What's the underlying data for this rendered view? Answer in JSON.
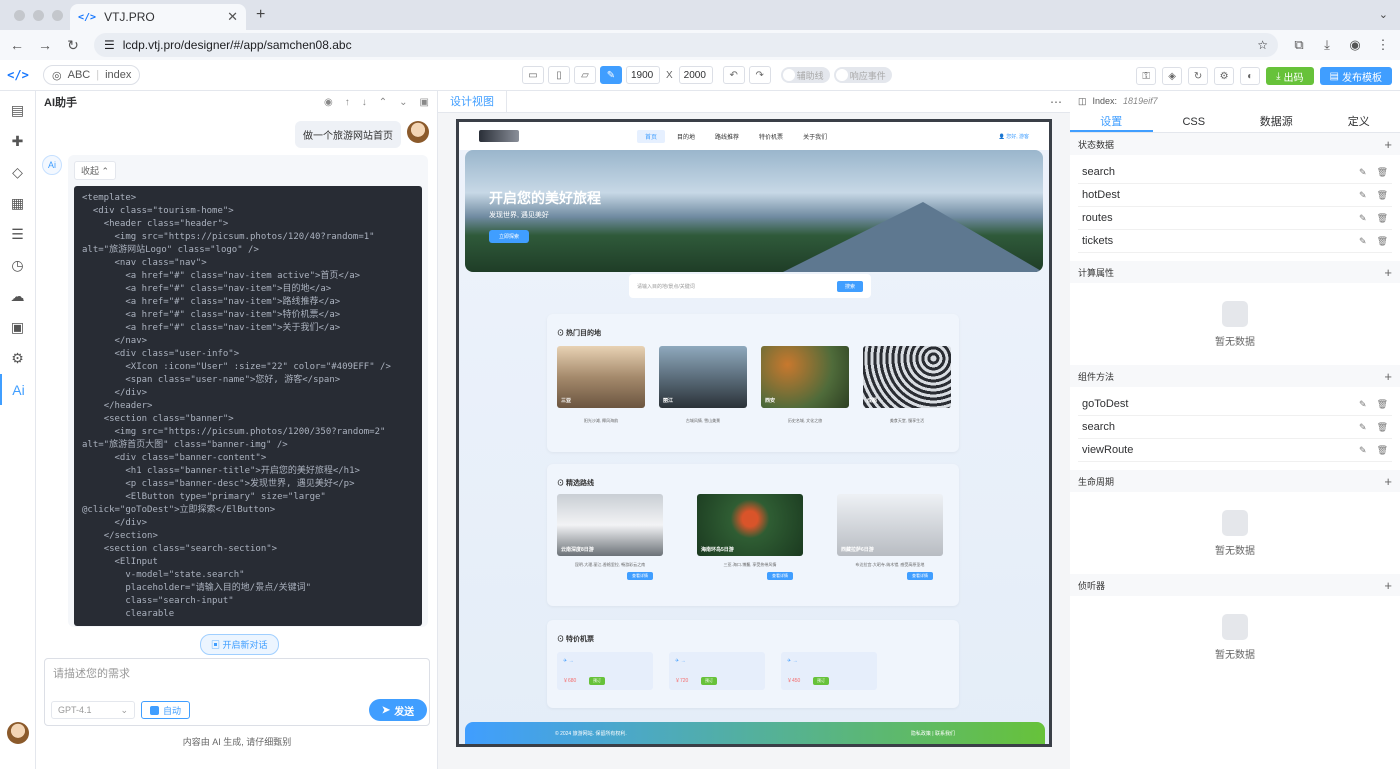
{
  "browser": {
    "tab_title": "VTJ.PRO",
    "url": "lcdp.vtj.pro/designer/#/app/samchen08.abc"
  },
  "toolbar": {
    "logo": "</>",
    "project": "ABC",
    "page": "index",
    "width": "1900",
    "x": "X",
    "height": "2000",
    "aux": "辅助线",
    "event": "响应事件",
    "export": "出码",
    "publish": "发布模板"
  },
  "ai": {
    "title": "AI助手",
    "user_msg": "做一个旅游网站首页",
    "collapse": "收起",
    "code": [
      "<template>",
      "  <div class=\"tourism-home\">",
      "    <header class=\"header\">",
      "      <img src=\"https://picsum.photos/120/40?random=1\" alt=\"旅游网站Logo\" class=\"logo\" />",
      "      <nav class=\"nav\">",
      "        <a href=\"#\" class=\"nav-item active\">首页</a>",
      "        <a href=\"#\" class=\"nav-item\">目的地</a>",
      "        <a href=\"#\" class=\"nav-item\">路线推荐</a>",
      "        <a href=\"#\" class=\"nav-item\">特价机票</a>",
      "        <a href=\"#\" class=\"nav-item\">关于我们</a>",
      "      </nav>",
      "      <div class=\"user-info\">",
      "        <XIcon :icon=\"User\" :size=\"22\" color=\"#409EFF\" />",
      "        <span class=\"user-name\">您好, 游客</span>",
      "      </div>",
      "    </header>",
      "    <section class=\"banner\">",
      "      <img src=\"https://picsum.photos/1200/350?random=2\" alt=\"旅游首页大图\" class=\"banner-img\" />",
      "      <div class=\"banner-content\">",
      "        <h1 class=\"banner-title\">开启您的美好旅程</h1>",
      "        <p class=\"banner-desc\">发现世界, 遇见美好</p>",
      "        <ElButton type=\"primary\" size=\"large\" @click=\"goToDest\">立即探索</ElButton>",
      "      </div>",
      "    </section>",
      "    <section class=\"search-section\">",
      "      <ElInput",
      "        v-model=\"state.search\"",
      "        placeholder=\"请输入目的地/景点/关键词\"",
      "        class=\"search-input\"",
      "        clearable"
    ],
    "new_chat": "开启新对话",
    "input_placeholder": "请描述您的需求",
    "model": "GPT-4.1",
    "auto": "自动",
    "send": "发送",
    "disclaimer": "内容由 AI 生成, 请仔细甄别"
  },
  "design": {
    "tab": "设计视图",
    "site": {
      "nav": [
        "首页",
        "目的地",
        "路线推荐",
        "特价机票",
        "关于我们"
      ],
      "user": "您好, 游客",
      "banner_title": "开启您的美好旅程",
      "banner_desc": "发现世界, 遇见美好",
      "banner_btn": "立即探索",
      "search_ph": "请输入目的地/景点/关键词",
      "search_btn": "搜索",
      "hot_title": "热门目的地",
      "dests": [
        {
          "name": "三亚",
          "desc": "阳光沙滩, 椰风海韵"
        },
        {
          "name": "丽江",
          "desc": "古城风情, 雪山美景"
        },
        {
          "name": "西安",
          "desc": "历史名城, 文化之旅"
        },
        {
          "name": "成都",
          "desc": "美食天堂, 慢享生活"
        }
      ],
      "route_title": "精选路线",
      "routes": [
        {
          "name": "云南深度8日游",
          "desc": "昆明-大理-丽江-香格里拉, 畅游彩云之南"
        },
        {
          "name": "海南环岛5日游",
          "desc": "三亚-海口-博鳌, 享受热带风情"
        },
        {
          "name": "西藏拉萨6日游",
          "desc": "布达拉宫-大昭寺-纳木错, 感受高原圣地"
        }
      ],
      "route_btn": "查看详情",
      "ticket_title": "特价机票",
      "tickets": [
        {
          "price": "￥680"
        },
        {
          "price": "￥720"
        },
        {
          "price": "￥450"
        }
      ],
      "ticket_btn": "预订",
      "footer_left": "© 2024 旅游网站. 保留所有权利.",
      "footer_right": "隐私政策 | 联系我们"
    }
  },
  "props": {
    "index_label": "Index:",
    "index": "1819eif7",
    "tabs": [
      "设置",
      "CSS",
      "数据源",
      "定义"
    ],
    "state_title": "状态数据",
    "state": [
      "search",
      "hotDest",
      "routes",
      "tickets"
    ],
    "computed_title": "计算属性",
    "empty": "暂无数据",
    "methods_title": "组件方法",
    "methods": [
      "goToDest",
      "search",
      "viewRoute"
    ],
    "lifecycle_title": "生命周期",
    "watch_title": "侦听器"
  }
}
